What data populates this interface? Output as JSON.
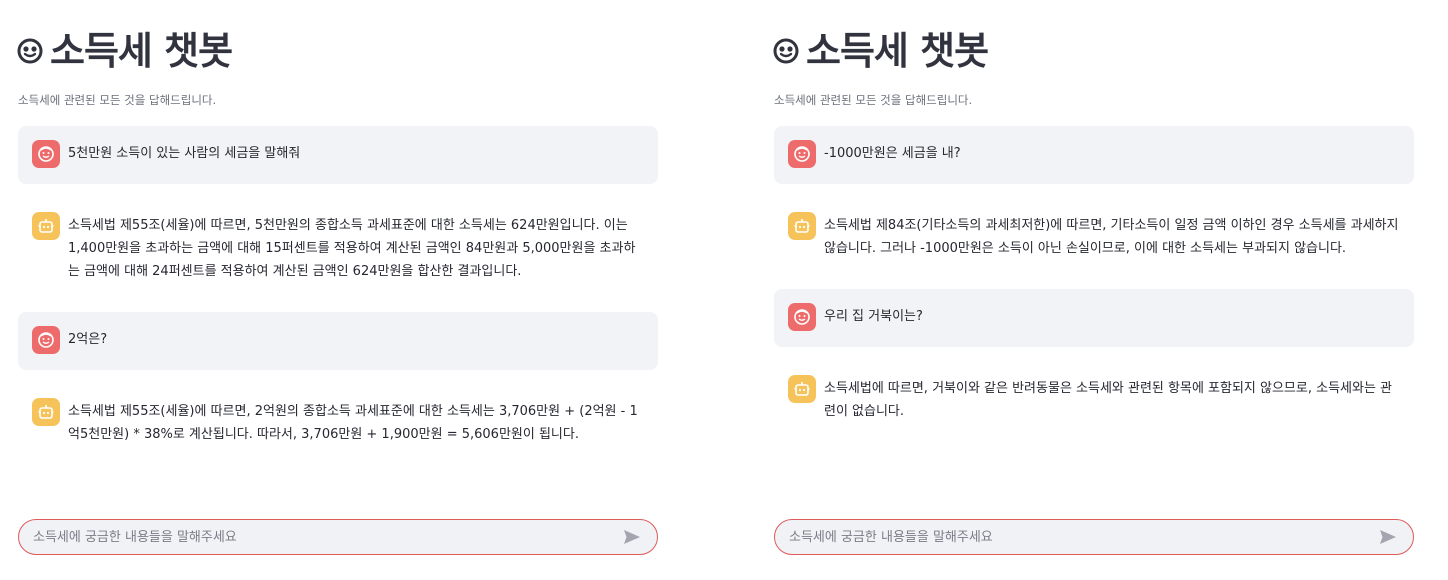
{
  "panels": [
    {
      "title": "소득세 챗봇",
      "subtitle": "소득세에 관련된 모든 것을 답해드립니다.",
      "messages": [
        {
          "role": "user",
          "text": "5천만원 소득이 있는 사람의 세금을 말해줘"
        },
        {
          "role": "assistant",
          "text": "소득세법 제55조(세율)에 따르면, 5천만원의 종합소득 과세표준에 대한 소득세는 624만원입니다. 이는 1,400만원을 초과하는 금액에 대해 15퍼센트를 적용하여 계산된 금액인 84만원과 5,000만원을 초과하는 금액에 대해 24퍼센트를 적용하여 계산된 금액인 624만원을 합산한 결과입니다."
        },
        {
          "role": "user",
          "text": "2억은?"
        },
        {
          "role": "assistant",
          "text": "소득세법 제55조(세율)에 따르면, 2억원의 종합소득 과세표준에 대한 소득세는 3,706만원 + (2억원 - 1억5천만원) * 38%로 계산됩니다. 따라서, 3,706만원 + 1,900만원 = 5,606만원이 됩니다."
        }
      ],
      "input": {
        "placeholder": "소득세에 궁금한 내용들을 말해주세요",
        "value": ""
      }
    },
    {
      "title": "소득세 챗봇",
      "subtitle": "소득세에 관련된 모든 것을 답해드립니다.",
      "messages": [
        {
          "role": "user",
          "text": "-1000만원은 세금을 내?"
        },
        {
          "role": "assistant",
          "text": "소득세법 제84조(기타소득의 과세최저한)에 따르면, 기타소득이 일정 금액 이하인 경우 소득세를 과세하지 않습니다. 그러나 -1000만원은 소득이 아닌 손실이므로, 이에 대한 소득세는 부과되지 않습니다."
        },
        {
          "role": "user",
          "text": "우리 집 거북이는?"
        },
        {
          "role": "assistant",
          "text": "소득세법에 따르면, 거북이와 같은 반려동물은 소득세와 관련된 항목에 포함되지 않으므로, 소득세와는 관련이 없습니다."
        }
      ],
      "input": {
        "placeholder": "소득세에 궁금한 내용들을 말해주세요",
        "value": ""
      }
    }
  ],
  "icons": {
    "title": "smiley-icon",
    "user_avatar": "user-face-icon",
    "assistant_avatar": "robot-icon",
    "send": "send-arrow-icon"
  },
  "colors": {
    "user_avatar": "#ee6b6b",
    "assistant_avatar": "#f6c35a",
    "user_bubble": "#f1f3f7",
    "input_border": "#e05a5a"
  }
}
